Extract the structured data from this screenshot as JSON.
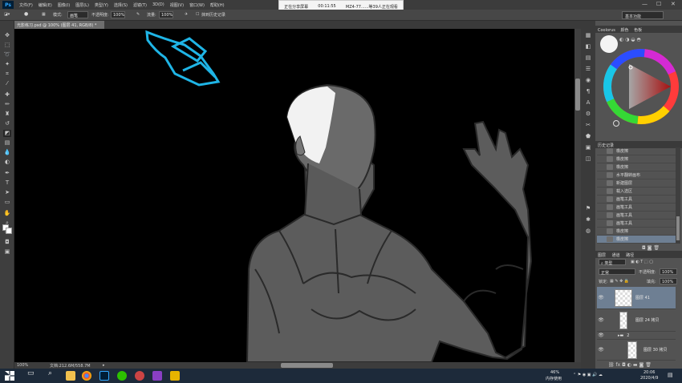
{
  "menubar": {
    "logo": "Ps",
    "items": [
      "文件(F)",
      "编辑(E)",
      "图像(I)",
      "图层(L)",
      "类型(Y)",
      "选择(S)",
      "滤镜(T)",
      "3D(D)",
      "视图(V)",
      "窗口(W)",
      "帮助(H)"
    ]
  },
  "share": {
    "status": "正在分享屏幕",
    "time": "00:11:55",
    "viewers": "MZ4-77......等39人正在观看"
  },
  "options": {
    "mode_label": "模式:",
    "mode_value": "画笔",
    "opacity_label": "不透明度:",
    "opacity_value": "100%",
    "flow_label": "流量:",
    "flow_value": "100%",
    "history_label": "抹到历史记录"
  },
  "workspace": "基本功能",
  "document": {
    "tab": "光影练习.psd @ 100% (图层 41, RGB/8) *",
    "zoom": "100%",
    "size": "文档:212.6M/558.7M"
  },
  "panels": {
    "color_tabs": [
      "Coolorus",
      "颜色",
      "色板"
    ],
    "history_title": "历史记录",
    "history": [
      {
        "label": "橡皮擦"
      },
      {
        "label": "橡皮擦"
      },
      {
        "label": "橡皮擦"
      },
      {
        "label": "水平翻转画布"
      },
      {
        "label": "新建图层"
      },
      {
        "label": "载入选区"
      },
      {
        "label": "画笔工具"
      },
      {
        "label": "画笔工具"
      },
      {
        "label": "画笔工具"
      },
      {
        "label": "画笔工具"
      },
      {
        "label": "橡皮擦"
      },
      {
        "label": "橡皮擦"
      }
    ],
    "layers_tabs": [
      "图层",
      "通道",
      "路径"
    ],
    "layers_kind": "类型",
    "blend_mode": "正常",
    "opacity_label": "不透明度:",
    "opacity_value": "100%",
    "lock_label": "锁定:",
    "fill_label": "填充:",
    "fill_value": "100%",
    "layers": [
      {
        "name": "图层 41"
      },
      {
        "name": "图层 24 拷贝"
      },
      {
        "name": "2"
      },
      {
        "name": "图层 30 拷贝"
      }
    ]
  },
  "taskbar": {
    "cpu": "46%",
    "cpu_label": "内存使用",
    "time": "20:06",
    "date": "2020/4/9"
  },
  "colors": {
    "brush_stroke": "#1fb5e6",
    "selection": "#6e7f93",
    "figure_fill": "#5c5c5c",
    "figure_line": "#2a2a2a",
    "highlight": "#f2f2f2"
  }
}
